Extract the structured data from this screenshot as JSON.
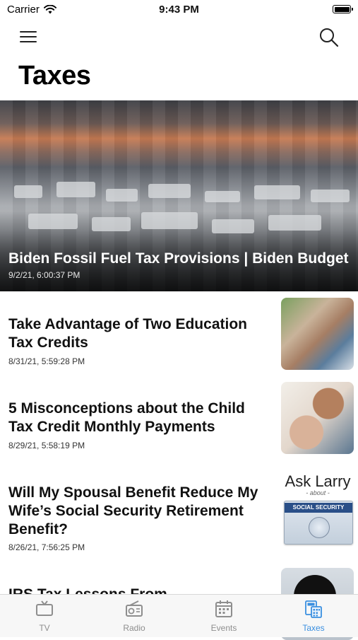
{
  "status_bar": {
    "carrier": "Carrier",
    "time": "9:43 PM"
  },
  "page": {
    "title": "Taxes"
  },
  "hero": {
    "title": "Biden Fossil Fuel Tax Provisions | Biden Budget",
    "date": "9/2/21, 6:00:37 PM"
  },
  "articles": [
    {
      "title": "Take Advantage of Two Education Tax Credits",
      "date": "8/31/21, 5:59:28 PM"
    },
    {
      "title": "5 Misconceptions about the Child Tax Credit Monthly Payments",
      "date": "8/29/21, 5:58:19 PM"
    },
    {
      "title": "Will My Spousal Benefit Reduce My Wife’s Social Security Retirement Benefit?",
      "date": "8/26/21, 7:56:25 PM"
    },
    {
      "title": "IRS Tax Lessons From"
    }
  ],
  "ask_larry": {
    "title": "Ask Larry",
    "subtitle": "- about -",
    "card_text": "SOCIAL SECURITY"
  },
  "tabs": [
    {
      "label": "TV",
      "icon": "tv-icon"
    },
    {
      "label": "Radio",
      "icon": "radio-icon"
    },
    {
      "label": "Events",
      "icon": "calendar-icon"
    },
    {
      "label": "Taxes",
      "icon": "calculator-icon",
      "active": true
    }
  ],
  "colors": {
    "accent": "#3a8fe0",
    "tab_inactive": "#8e8e8e"
  }
}
